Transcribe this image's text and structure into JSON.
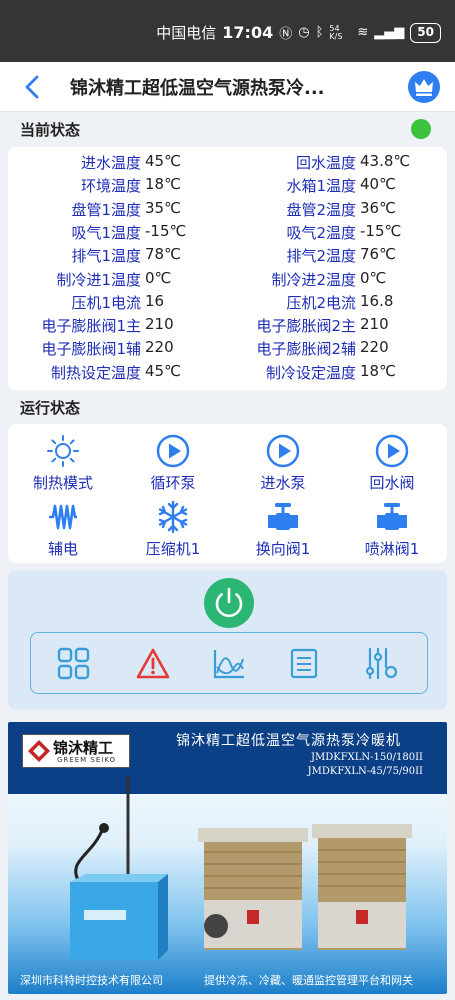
{
  "status_bar": {
    "carrier": "中国电信",
    "time": "17:04",
    "net_speed": "54 K/S",
    "battery": "50"
  },
  "header": {
    "title": "锦沐精工超低温空气源热泵冷..."
  },
  "current_status": {
    "section_title": "当前状态",
    "rows": [
      {
        "label1": "进水温度",
        "value1": "45℃",
        "label2": "回水温度",
        "value2": "43.8℃"
      },
      {
        "label1": "环境温度",
        "value1": "18℃",
        "label2": "水箱1温度",
        "value2": "40℃"
      },
      {
        "label1": "盘管1温度",
        "value1": "35℃",
        "label2": "盘管2温度",
        "value2": "36℃"
      },
      {
        "label1": "吸气1温度",
        "value1": "-15℃",
        "label2": "吸气2温度",
        "value2": "-15℃"
      },
      {
        "label1": "排气1温度",
        "value1": "78℃",
        "label2": "排气2温度",
        "value2": "76℃"
      },
      {
        "label1": "制冷进1温度",
        "value1": "0℃",
        "label2": "制冷进2温度",
        "value2": "0℃"
      },
      {
        "label1": "压机1电流",
        "value1": "16",
        "label2": "压机2电流",
        "value2": "16.8"
      },
      {
        "label1": "电子膨胀阀1主",
        "value1": "210",
        "label2": "电子膨胀阀2主",
        "value2": "210"
      },
      {
        "label1": "电子膨胀阀1辅",
        "value1": "220",
        "label2": "电子膨胀阀2辅",
        "value2": "220"
      },
      {
        "label1": "制热设定温度",
        "value1": "45℃",
        "label2": "制冷设定温度",
        "value2": "18℃"
      }
    ]
  },
  "run_status": {
    "section_title": "运行状态",
    "items": [
      {
        "label": "制热模式",
        "icon": "sun-icon"
      },
      {
        "label": "循环泵",
        "icon": "play-circle-icon"
      },
      {
        "label": "进水泵",
        "icon": "play-circle-icon"
      },
      {
        "label": "回水阀",
        "icon": "play-circle-icon"
      },
      {
        "label": "辅电",
        "icon": "heater-icon"
      },
      {
        "label": "压缩机1",
        "icon": "snowflake-icon"
      },
      {
        "label": "换向阀1",
        "icon": "valve-icon"
      },
      {
        "label": "喷淋阀1",
        "icon": "valve-icon"
      }
    ]
  },
  "controls": {
    "power_icon": "power-icon",
    "tools": [
      "grid-icon",
      "alarm-icon",
      "chart-icon",
      "list-icon",
      "settings-sliders-icon"
    ]
  },
  "banner": {
    "logo_cn": "锦沐精工",
    "logo_en": "GREEM SEIKO",
    "title": "锦沐精工超低温空气源热泵冷暖机",
    "model1": "JMDKFXLN-150/180II",
    "model2": "JMDKFXLN-45/75/90II",
    "footer_left": "深圳市科特时控技术有限公司",
    "footer_right": "提供冷冻、冷藏、暖通监控管理平台和网关"
  },
  "colors": {
    "accent": "#2f7ef0",
    "label_blue": "#1f2fb8",
    "online": "#3cc23c",
    "power": "#2bb673",
    "alarm": "#e53935"
  }
}
